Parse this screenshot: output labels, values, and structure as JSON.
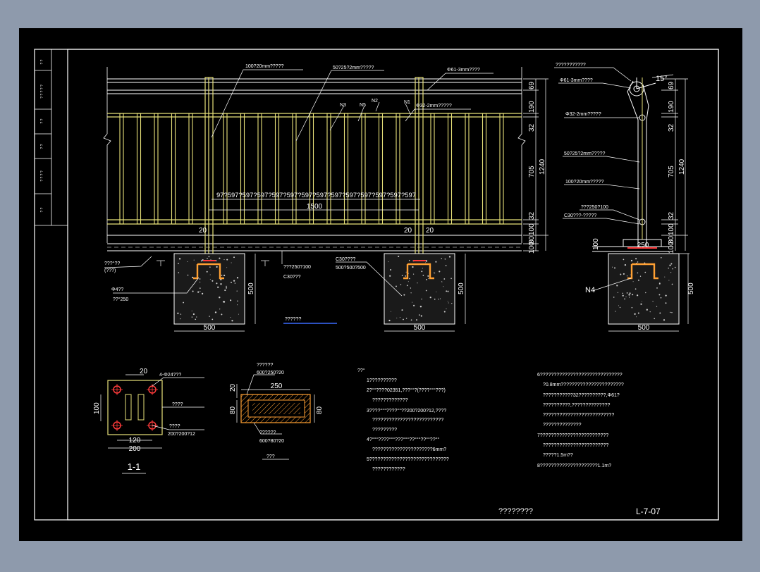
{
  "colors": {
    "background": "#8e9aac",
    "paper": "#000000",
    "frame": "#ffffff",
    "rail": "#e8e27a",
    "dim": "#ffffff",
    "red": "#ff3b3b",
    "blue": "#3a6cff",
    "orange": "#ffa033",
    "concrete": "#1a1a1a"
  },
  "elevation": {
    "leader_labels": [
      "100?20mm?????",
      "50?25?2mm?????",
      "Φ61-3mm????",
      "Φ32-2mm?????"
    ],
    "marks": [
      "N3",
      "N5",
      "N2",
      "N1"
    ],
    "spacing_label": "97?597?597?597?597?597?597?597?597?597?597?597?597?597",
    "span_dim": "1500",
    "post_dims": [
      "20",
      "20",
      "20"
    ],
    "right_vdims": [
      "69",
      "190",
      "32",
      "705",
      "1240",
      "32",
      "100",
      "80",
      "100"
    ],
    "deck_note_1": "???°??",
    "deck_note_2": "(???)",
    "bolt_note_1": "Φ4??",
    "bolt_note_2": "??°250",
    "mid_note_1": "???250?100",
    "mid_note_2": "C30???",
    "footing_note_1": "C30????",
    "footing_note_2": "500?500?500",
    "footing_width": "500",
    "footing_height": "500",
    "center_mark": "??????"
  },
  "section": {
    "top_label": "???????????",
    "angle": "15°",
    "labels": [
      "Φ61-3mm????",
      "Φ32-2mm?????",
      "50?25?2mm?????",
      "100?20mm?????",
      "???250?100",
      "C30???-?????"
    ],
    "dim_250": "250",
    "dim_100": "100",
    "mark_n4": "N4",
    "footing_width": "500",
    "footing_height": "500"
  },
  "plate": {
    "dim_20": "20",
    "hole_label": "4-Φ24???",
    "label_2": "????",
    "label_3": "????",
    "label_4": "200?200?12",
    "dim_100": "100",
    "dim_120": "120",
    "dim_200": "200",
    "title": "1-1"
  },
  "pad": {
    "label_1": "??????",
    "label_2": "600?250?20",
    "dim_250": "250",
    "dim_20": "20",
    "dim_80_left": "80",
    "dim_80_right": "80",
    "label_3": "??????",
    "label_4": "600?80?20",
    "title": "???"
  },
  "notes_left": [
    "??°",
    "1??????????",
    "2?°°????02351,???°°?(????°°°???)",
    "?????????????",
    "3????°°°????°°??200?200?12,????",
    "??????????????????????????",
    "?????????",
    "4?°°°????°°°???°°°??°°°??°°??°°",
    "??????????????????????6mm?",
    "5?????????????????????????????",
    "????????????"
  ],
  "notes_right": [
    "6??????????????????????????????",
    "?0.8mm???????????????????????",
    "???????????32??????????,Φ61?",
    "??????????,??????????????",
    "??????????????????????????",
    "??????????????",
    "7?????????????????????????",
    "????????????????????????",
    "?????1.5m??",
    "8?????????????????????1.1m?"
  ],
  "title_block": {
    "drawing_name": "????????",
    "drawing_number": "L-7-07",
    "side_cells": [
      "? ?",
      "? ? ? ? ?",
      "? ?",
      "? ?",
      "? ? ? ?",
      "? ?"
    ]
  }
}
